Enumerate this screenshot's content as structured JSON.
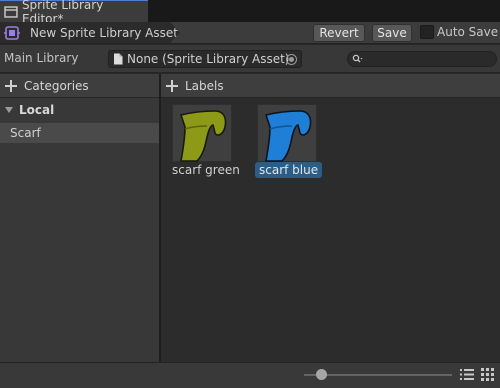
{
  "window": {
    "tab_title": "Sprite Library Editor*"
  },
  "toolbar": {
    "asset_name": "New Sprite Library Asset",
    "revert_label": "Revert",
    "save_label": "Save",
    "autosave_label": "Auto Save",
    "autosave_checked": false
  },
  "main_library": {
    "label": "Main Library",
    "value": "None (Sprite Library Asset)"
  },
  "search": {
    "value": ""
  },
  "categories": {
    "header": "Categories",
    "groups": [
      {
        "label": "Local",
        "expanded": true,
        "items": [
          {
            "label": "Scarf",
            "selected": true
          }
        ]
      }
    ]
  },
  "labels": {
    "header": "Labels",
    "items": [
      {
        "label": "scarf green",
        "color": "#8c9a18",
        "selected": false
      },
      {
        "label": "scarf blue",
        "color": "#1f7fd6",
        "selected": true
      }
    ]
  },
  "footer": {
    "zoom_fraction": 0.1,
    "view_modes": [
      "list-view",
      "grid-view"
    ]
  },
  "colors": {
    "selection": "#2c5d87",
    "tab_accent": "#4d7ed3"
  }
}
